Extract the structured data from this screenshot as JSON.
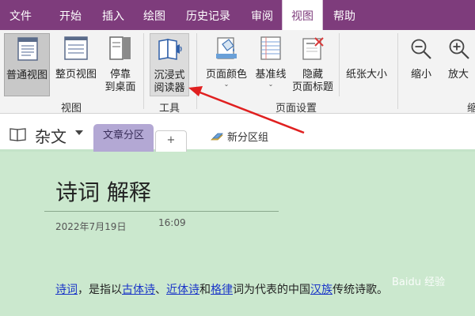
{
  "menubar": {
    "items": [
      "文件",
      "开始",
      "插入",
      "绘图",
      "历史记录",
      "审阅",
      "视图",
      "帮助"
    ],
    "active": "视图"
  },
  "ribbon": {
    "groups": {
      "view": {
        "label": "视图",
        "buttons": {
          "normal_view": "普通视图",
          "full_page_view": "整页视图",
          "dock_line1": "停靠",
          "dock_line2": "到桌面"
        }
      },
      "tools": {
        "label": "工具",
        "buttons": {
          "immersive_line1": "沉浸式",
          "immersive_line2": "阅读器"
        }
      },
      "page_setup": {
        "label": "页面设置",
        "buttons": {
          "page_color": "页面颜色",
          "rule_lines": "基准线",
          "hide_title_line1": "隐藏",
          "hide_title_line2": "页面标题",
          "paper_size": "纸张大小"
        }
      },
      "zoom": {
        "buttons": {
          "zoom_out": "缩小",
          "zoom_in": "放大"
        },
        "label_partial": "缩"
      }
    }
  },
  "notebook": {
    "name": "杂文",
    "section_active": "文章分区",
    "add_tab": "+",
    "new_section_group": "新分区组"
  },
  "page": {
    "title": "诗词 解释",
    "date": "2022年7月19日",
    "time": "16:09",
    "body": {
      "link1": "诗词",
      "t1": "，是指以",
      "link2": "古体诗",
      "t2": "、",
      "link3": "近体诗",
      "t3": "和",
      "link4": "格律",
      "t4": "词为代表的中国",
      "link5": "汉族",
      "t5": "传统诗歌。"
    }
  },
  "watermark": "Baidu 经验",
  "colors": {
    "brand": "#7e3c7c",
    "section_tab": "#b3a8d4",
    "page_bg": "#cbe8ce",
    "arrow": "#e02020"
  }
}
